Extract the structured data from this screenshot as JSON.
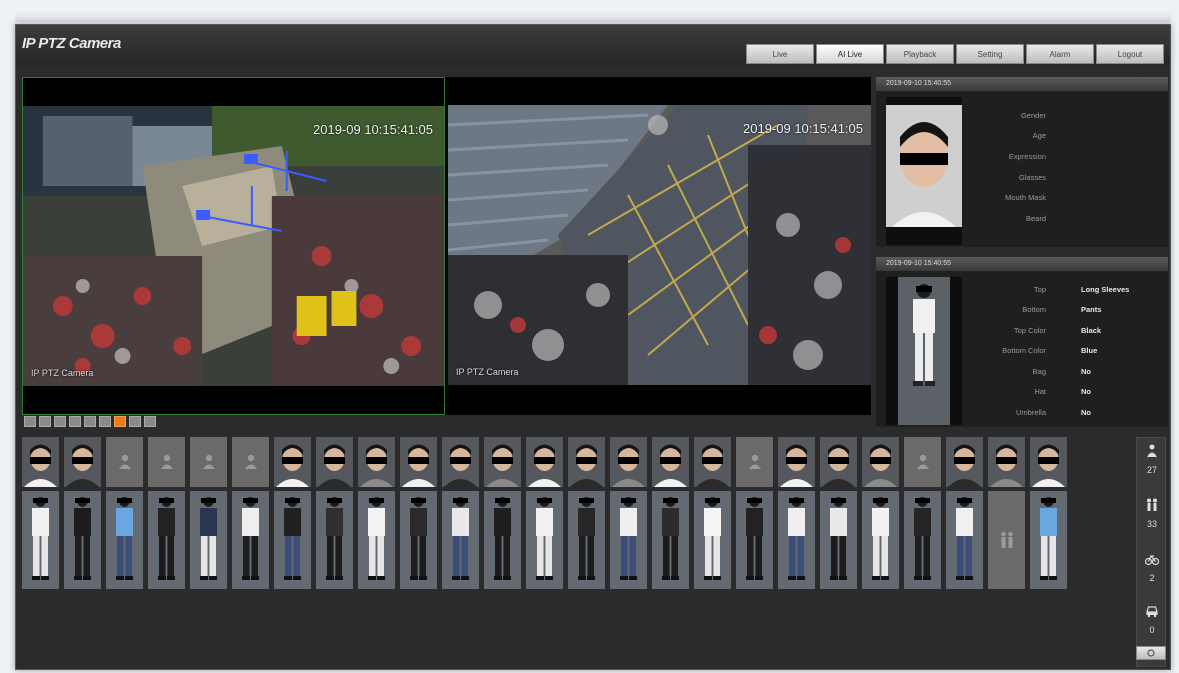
{
  "app": {
    "title": "IP PTZ Camera"
  },
  "nav": [
    {
      "label": "Live",
      "active": false
    },
    {
      "label": "AI Live",
      "active": true
    },
    {
      "label": "Playback",
      "active": false
    },
    {
      "label": "Setting",
      "active": false
    },
    {
      "label": "Alarm",
      "active": false
    },
    {
      "label": "Logout",
      "active": false
    }
  ],
  "cameras": [
    {
      "timestamp": "2019-09 10:15:41:05",
      "name": "IP PTZ Camera"
    },
    {
      "timestamp": "2019-09 10:15:41:05",
      "name": "IP PTZ Camera"
    }
  ],
  "face_panel": {
    "capture_time": "2019-09-10 15:40:55",
    "attributes": [
      {
        "label": "Gender",
        "value": ""
      },
      {
        "label": "Age",
        "value": ""
      },
      {
        "label": "Expression",
        "value": ""
      },
      {
        "label": "Glasses",
        "value": ""
      },
      {
        "label": "Mouth Mask",
        "value": ""
      },
      {
        "label": "Beard",
        "value": ""
      }
    ]
  },
  "body_panel": {
    "capture_time": "2019-09-10 15:40:55",
    "attributes": [
      {
        "label": "Top",
        "value": "Long Sleeves"
      },
      {
        "label": "Bottom",
        "value": "Pants"
      },
      {
        "label": "Top Color",
        "value": "Black"
      },
      {
        "label": "Bottom Color",
        "value": "Blue"
      },
      {
        "label": "Bag",
        "value": "No"
      },
      {
        "label": "Hat",
        "value": "No"
      },
      {
        "label": "Umbrella",
        "value": "No"
      }
    ]
  },
  "face_thumbs": [
    "face",
    "face",
    "placeholder",
    "placeholder",
    "placeholder",
    "placeholder",
    "face",
    "face",
    "face",
    "face",
    "face",
    "face",
    "face",
    "face",
    "face",
    "face",
    "face",
    "placeholder",
    "face",
    "face",
    "face",
    "placeholder",
    "face",
    "face",
    "face"
  ],
  "body_thumbs": [
    "body",
    "body",
    "body",
    "body",
    "body",
    "body",
    "body",
    "body",
    "body",
    "body",
    "body",
    "body",
    "body",
    "body",
    "body",
    "body",
    "body",
    "body",
    "body",
    "body",
    "body",
    "body",
    "body",
    "placeholder",
    "body"
  ],
  "stats": {
    "faces": {
      "icon": "person-icon",
      "count": "27"
    },
    "bodies": {
      "icon": "people-icon",
      "count": "33"
    },
    "bicycles": {
      "icon": "bicycle-icon",
      "count": "2"
    },
    "vehicles": {
      "icon": "car-icon",
      "count": "0"
    }
  },
  "colors": {
    "accent": "#e67e1a",
    "frame": "#2b2b2b",
    "panel": "#1f1f1f"
  }
}
